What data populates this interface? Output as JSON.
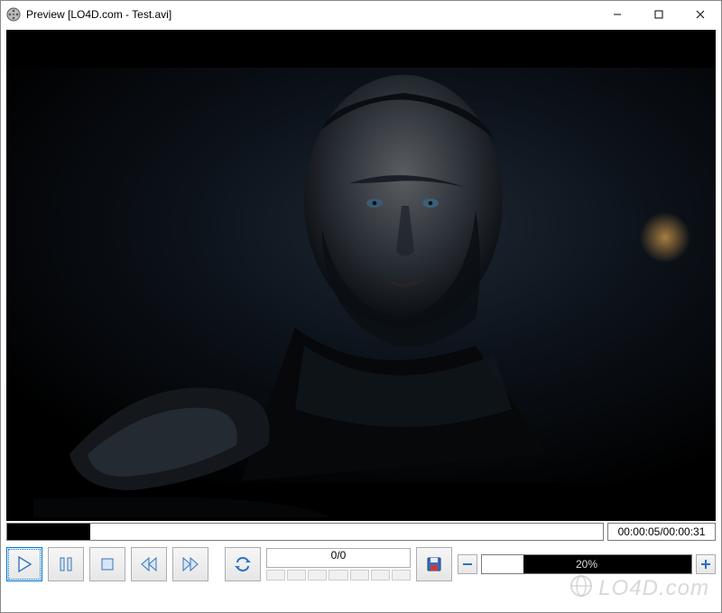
{
  "window": {
    "title": "Preview [LO4D.com - Test.avi]"
  },
  "playback": {
    "elapsed": "00:00:05",
    "total": "00:00:31",
    "time_display": "00:00:05/00:00:31",
    "progress_percent": 14
  },
  "frame": {
    "display": "0/0"
  },
  "speed": {
    "percent_label": "20%",
    "fill_percent": 20
  },
  "buttons": {
    "play": "Play",
    "pause": "Pause",
    "stop": "Stop",
    "rewind": "Rewind",
    "fast_forward": "Fast Forward",
    "loop": "Loop",
    "save": "Save",
    "minus": "−",
    "plus": "+"
  },
  "icons": {
    "app": "film-reel-icon",
    "minimize": "minimize-icon",
    "maximize": "maximize-icon",
    "close": "close-icon"
  },
  "watermark": "LO4D.com"
}
